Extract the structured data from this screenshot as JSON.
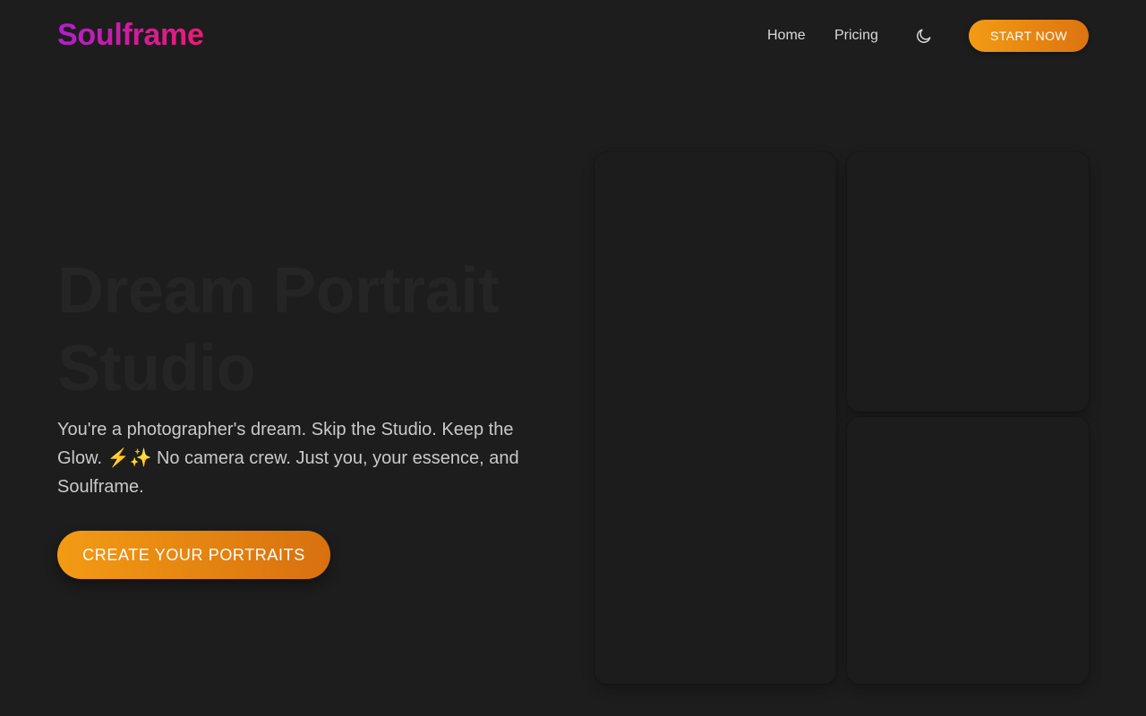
{
  "header": {
    "logo": "Soulframe",
    "nav": [
      {
        "label": "Home"
      },
      {
        "label": "Pricing"
      }
    ],
    "theme_toggle_icon": "moon-icon",
    "start_button": "START NOW"
  },
  "hero": {
    "title": "Dream Portrait Studio",
    "text": "You're a photographer's dream. Skip the Studio. Keep the Glow. ⚡✨ No camera crew. Just you, your essence, and Soulframe.",
    "cta": "CREATE YOUR PORTRAITS"
  },
  "colors": {
    "background": "#1d1d1d",
    "accent_orange": "#f39b14",
    "logo_gradient_start": "#b01fcb",
    "logo_gradient_end": "#ef1a74"
  }
}
